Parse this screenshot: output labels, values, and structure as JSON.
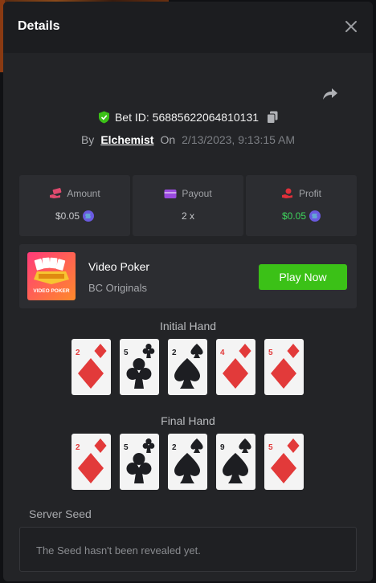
{
  "modal": {
    "title": "Details"
  },
  "bet": {
    "id_label": "Bet ID: 56885622064810131",
    "by_label": "By",
    "user": "Elchemist",
    "on_label": "On",
    "date": "2/13/2023, 9:13:15 AM"
  },
  "stats": {
    "amount": {
      "label": "Amount",
      "value": "$0.05",
      "icon": "money-hand-icon"
    },
    "payout": {
      "label": "Payout",
      "value": "2 x",
      "icon": "wallet-icon"
    },
    "profit": {
      "label": "Profit",
      "value": "$0.05",
      "icon": "hand-coin-icon"
    }
  },
  "game": {
    "name": "Video Poker",
    "provider": "BC Originals",
    "thumb_text": "VIDEO POKER",
    "play_label": "Play Now"
  },
  "initial_hand": {
    "title": "Initial Hand",
    "cards": [
      {
        "rank": "2",
        "suit": "diamonds",
        "color": "red"
      },
      {
        "rank": "5",
        "suit": "clubs",
        "color": "black"
      },
      {
        "rank": "2",
        "suit": "spades",
        "color": "black"
      },
      {
        "rank": "4",
        "suit": "diamonds",
        "color": "red"
      },
      {
        "rank": "5",
        "suit": "diamonds",
        "color": "red"
      }
    ]
  },
  "final_hand": {
    "title": "Final Hand",
    "cards": [
      {
        "rank": "2",
        "suit": "diamonds",
        "color": "red"
      },
      {
        "rank": "5",
        "suit": "clubs",
        "color": "black"
      },
      {
        "rank": "2",
        "suit": "spades",
        "color": "black"
      },
      {
        "rank": "9",
        "suit": "spades",
        "color": "black"
      },
      {
        "rank": "5",
        "suit": "diamonds",
        "color": "red"
      }
    ]
  },
  "seed": {
    "label": "Server Seed",
    "text": "The Seed hasn't been revealed yet."
  },
  "colors": {
    "accent_green": "#3bc117",
    "profit_green": "#3fd55d",
    "card_red": "#e23a3a"
  }
}
